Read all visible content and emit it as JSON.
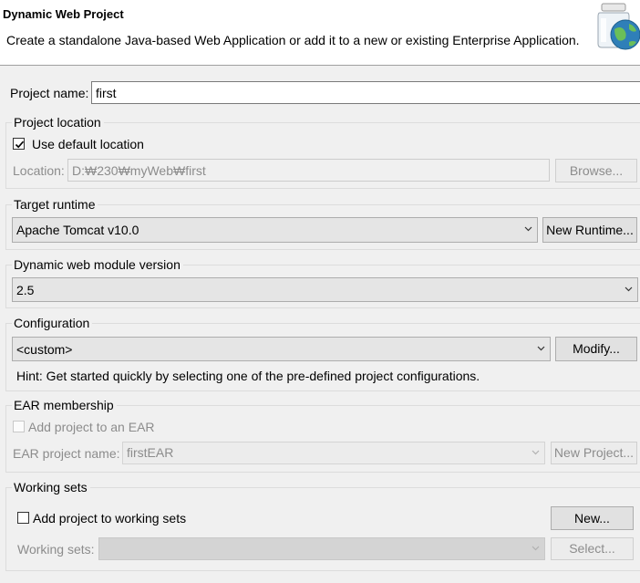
{
  "header": {
    "title": "Dynamic Web Project",
    "description": "Create a standalone Java-based Web Application or add it to a new or existing Enterprise Application.",
    "icon": "web-project-jar-globe-icon"
  },
  "project_name": {
    "label": "Project name:",
    "value": "first"
  },
  "project_location": {
    "title": "Project location",
    "use_default_label": "Use default location",
    "use_default_checked": true,
    "location_label": "Location:",
    "location_value": "D:₩230₩myWeb₩first",
    "browse_label": "Browse..."
  },
  "target_runtime": {
    "title": "Target runtime",
    "selected": "Apache Tomcat v10.0",
    "new_runtime_label": "New Runtime..."
  },
  "web_module": {
    "title": "Dynamic web module version",
    "selected": "2.5"
  },
  "configuration": {
    "title": "Configuration",
    "selected": "<custom>",
    "modify_label": "Modify...",
    "hint": "Hint: Get started quickly by selecting one of the pre-defined project configurations."
  },
  "ear": {
    "title": "EAR membership",
    "add_label": "Add project to an EAR",
    "add_checked": false,
    "name_label": "EAR project name:",
    "name_value": "firstEAR",
    "new_project_label": "New Project..."
  },
  "working_sets": {
    "title": "Working sets",
    "add_label": "Add project to working sets",
    "add_checked": false,
    "new_label": "New...",
    "sets_label": "Working sets:",
    "select_label": "Select..."
  }
}
